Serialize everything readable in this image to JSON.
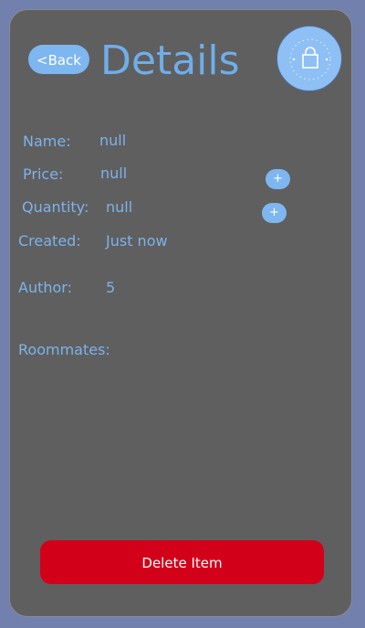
{
  "header": {
    "back_label": "<Back",
    "title": "Details",
    "logo_icon": "shopping-bag-logo-icon"
  },
  "fields": [
    {
      "label": "Name:",
      "value": "null"
    },
    {
      "label": "Price:",
      "value": "null"
    },
    {
      "label": "Quantity:",
      "value": "null"
    },
    {
      "label": "Created:",
      "value": "Just now"
    },
    {
      "label": "Author:",
      "value": "5"
    },
    {
      "label": "Roommates:",
      "value": ""
    }
  ],
  "controls": {
    "price_increment_label": "+",
    "quantity_increment_label": "+",
    "delete_label": "Delete Item"
  },
  "colors": {
    "background": "#7180ad",
    "card": "#5f5f5f",
    "accent": "#7eb6f0",
    "text": "#7db3ea",
    "danger": "#d3001a"
  }
}
